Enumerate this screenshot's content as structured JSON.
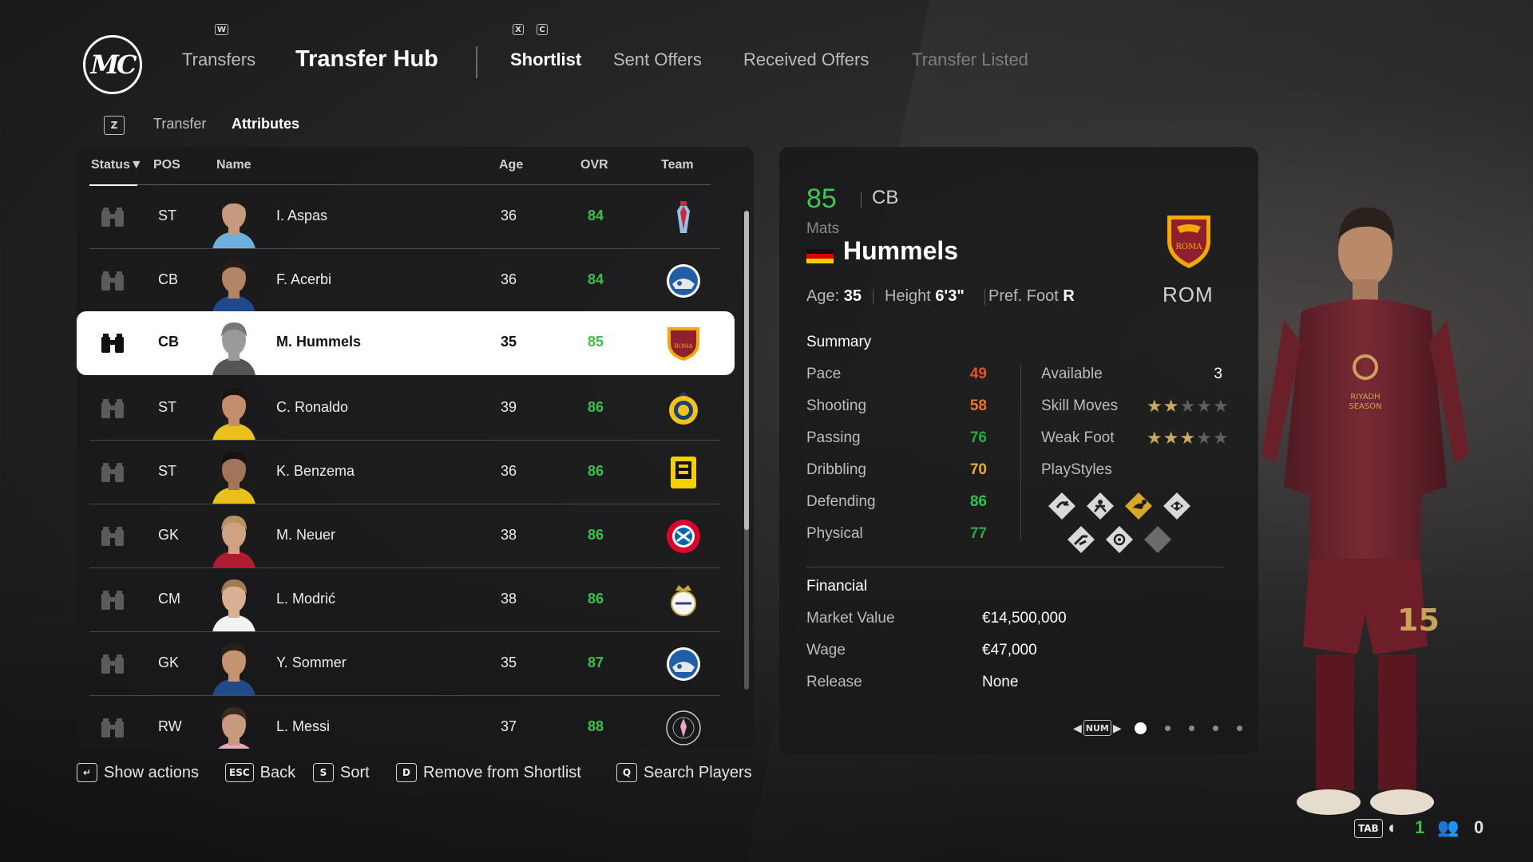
{
  "header": {
    "logo_text": "MC",
    "nav": [
      {
        "label": "Transfers",
        "key": "W"
      },
      {
        "label": "Transfer Hub",
        "key": ""
      },
      {
        "label": "Shortlist",
        "keys": [
          "X",
          "C"
        ]
      },
      {
        "label": "Sent Offers"
      },
      {
        "label": "Received Offers"
      },
      {
        "label": "Transfer Listed"
      }
    ],
    "subnav": {
      "key": "Z",
      "tabs": [
        "Transfer",
        "Attributes"
      ],
      "active": "Attributes"
    }
  },
  "table": {
    "columns": [
      "Status",
      "POS",
      "Name",
      "Age",
      "OVR",
      "Team"
    ],
    "sort_indicator": "▼",
    "rows": [
      {
        "pos": "ST",
        "name": "I. Aspas",
        "age": "36",
        "ovr": "84",
        "team": "celta"
      },
      {
        "pos": "CB",
        "name": "F. Acerbi",
        "age": "36",
        "ovr": "84",
        "team": "inter"
      },
      {
        "pos": "CB",
        "name": "M. Hummels",
        "age": "35",
        "ovr": "85",
        "team": "roma",
        "selected": true
      },
      {
        "pos": "ST",
        "name": "C. Ronaldo",
        "age": "39",
        "ovr": "86",
        "team": "al-nassr"
      },
      {
        "pos": "ST",
        "name": "K. Benzema",
        "age": "36",
        "ovr": "86",
        "team": "al-ittihad"
      },
      {
        "pos": "GK",
        "name": "M. Neuer",
        "age": "38",
        "ovr": "86",
        "team": "bayern"
      },
      {
        "pos": "CM",
        "name": "L. Modrić",
        "age": "38",
        "ovr": "86",
        "team": "real-madrid"
      },
      {
        "pos": "GK",
        "name": "Y. Sommer",
        "age": "35",
        "ovr": "87",
        "team": "inter"
      },
      {
        "pos": "RW",
        "name": "L. Messi",
        "age": "37",
        "ovr": "88",
        "team": "inter-miami"
      }
    ]
  },
  "player": {
    "ovr": "85",
    "pos": "CB",
    "first_name": "Mats",
    "last_name": "Hummels",
    "age_label": "Age:",
    "age": "35",
    "height_label": "Height",
    "height": "6'3\"",
    "foot_label": "Pref. Foot",
    "foot": "R",
    "team": "ROM",
    "nationality": "Germany"
  },
  "summary": {
    "title": "Summary",
    "stats": [
      {
        "label": "Pace",
        "value": "49",
        "color": "#e0532f"
      },
      {
        "label": "Shooting",
        "value": "58",
        "color": "#e5772e"
      },
      {
        "label": "Passing",
        "value": "76",
        "color": "#2aa84a"
      },
      {
        "label": "Dribbling",
        "value": "70",
        "color": "#e9b12a"
      },
      {
        "label": "Defending",
        "value": "86",
        "color": "#2fc455"
      },
      {
        "label": "Physical",
        "value": "77",
        "color": "#2aa84a"
      }
    ],
    "available_label": "Available",
    "available": "3",
    "skill_moves_label": "Skill Moves",
    "skill_moves": 2,
    "weak_foot_label": "Weak Foot",
    "weak_foot": 3,
    "playstyles_label": "PlayStyles"
  },
  "financial": {
    "title": "Financial",
    "items": [
      {
        "label": "Market Value",
        "value": "€14,500,000"
      },
      {
        "label": "Wage",
        "value": "€47,000"
      },
      {
        "label": "Release",
        "value": "None"
      }
    ]
  },
  "pager": {
    "key": "NUM",
    "pages": 5,
    "current": 1
  },
  "actions": [
    {
      "key": "↵",
      "label": "Show actions"
    },
    {
      "key": "ESC",
      "label": "Back"
    },
    {
      "key": "S",
      "label": "Sort"
    },
    {
      "key": "D",
      "label": "Remove from Shortlist"
    },
    {
      "key": "Q",
      "label": "Search Players"
    }
  ],
  "corner": {
    "key": "TAB",
    "count1": "1",
    "count2": "0"
  },
  "colors": {
    "ovr_green": "#39c14a",
    "selected_row": "#ffffff",
    "star_on": "#c9aa5e",
    "roma_maroon": "#7a1f2b"
  }
}
